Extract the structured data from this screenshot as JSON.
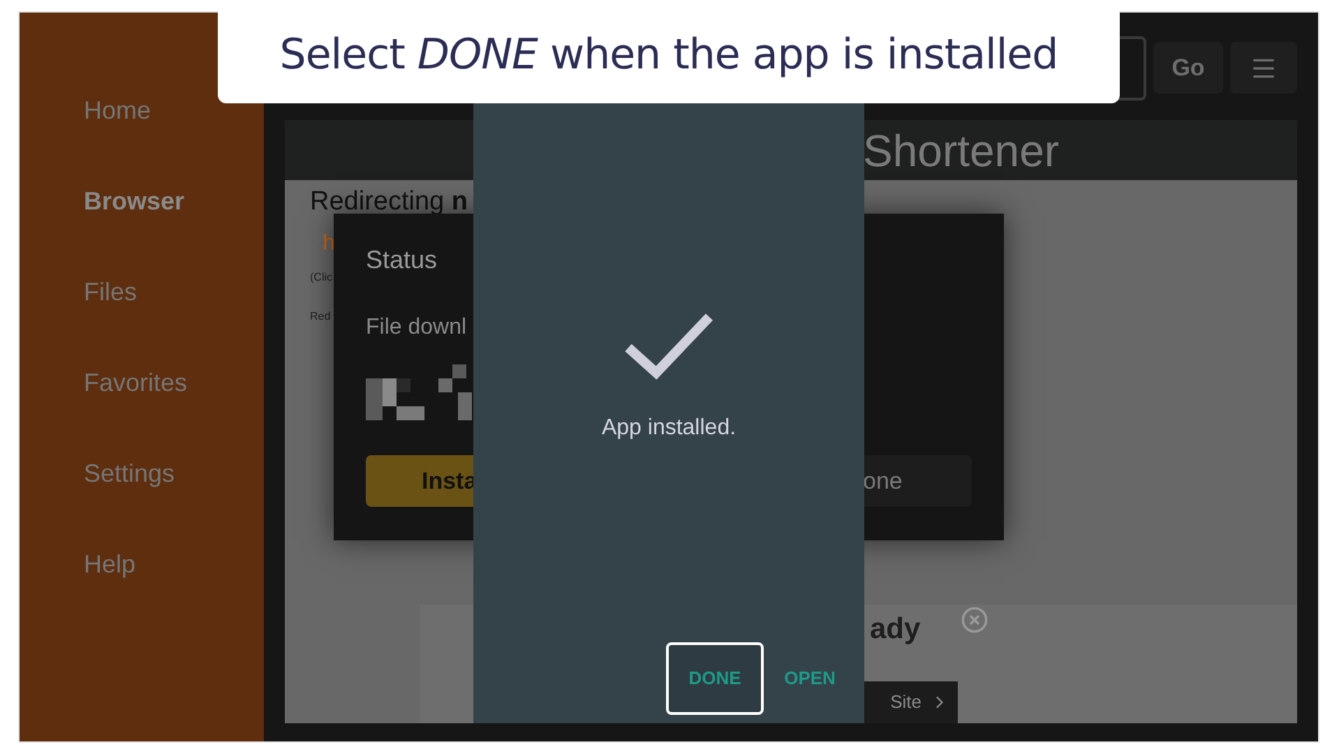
{
  "callout": {
    "text": "Select *DONE* when the app is installed"
  },
  "sidebar": {
    "items": [
      {
        "label": "Home",
        "selected": false
      },
      {
        "label": "Browser",
        "selected": true
      },
      {
        "label": "Files",
        "selected": false
      },
      {
        "label": "Favorites",
        "selected": false
      },
      {
        "label": "Settings",
        "selected": false
      },
      {
        "label": "Help",
        "selected": false
      }
    ]
  },
  "toolbar": {
    "go_button": "Go"
  },
  "page": {
    "header_title": "Shortener",
    "heading": "Redirecting **n**",
    "link": "h",
    "note": "(Clic",
    "line": "Red",
    "ad_heading": "ady",
    "ad_button": "Site"
  },
  "status_dialog": {
    "title": "Status",
    "message": "File downl",
    "install_button": "Insta",
    "done_button": "one"
  },
  "install_dialog": {
    "message": "App installed.",
    "buttons": [
      {
        "label": "DONE",
        "selected": true
      },
      {
        "label": "OPEN",
        "selected": false
      }
    ]
  }
}
